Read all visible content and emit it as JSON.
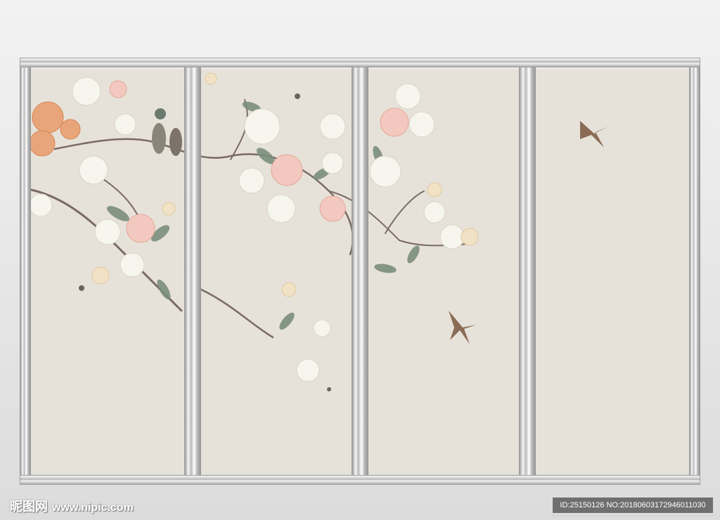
{
  "image": {
    "subject": "four-panel screen mural",
    "colors": {
      "panel": "#e7e2d9",
      "frame": "#c7c7c7",
      "petal_white": "#f6f5ee",
      "petal_pink": "#f3c9bf",
      "petal_orange": "#e9a57a",
      "leaf": "#7b8e7c",
      "branch": "#7a6a66"
    }
  },
  "watermark": {
    "site": "昵图网",
    "url": "www.nipic.com",
    "id_text": "ID:25150126 NO:20180603172946011030"
  }
}
